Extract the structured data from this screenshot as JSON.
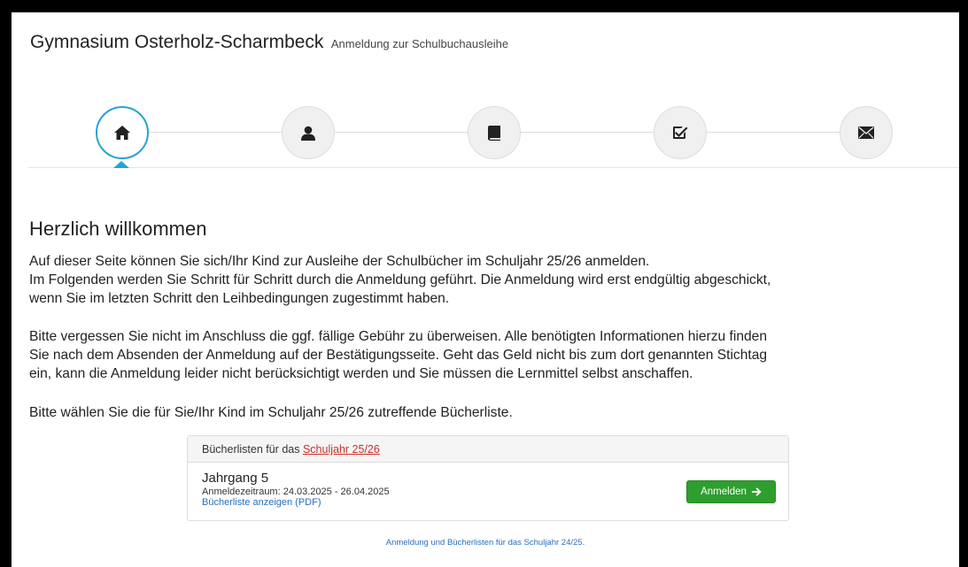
{
  "header": {
    "brand": "Gymnasium Osterholz-Scharmbeck",
    "subtitle": "Anmeldung zur Schulbuchausleihe"
  },
  "wizard": {
    "steps": [
      {
        "icon": "home-icon",
        "active": true
      },
      {
        "icon": "user-icon",
        "active": false
      },
      {
        "icon": "book-icon",
        "active": false
      },
      {
        "icon": "check-square-icon",
        "active": false
      },
      {
        "icon": "envelope-icon",
        "active": false
      }
    ],
    "accent_color": "#27a2d6"
  },
  "content": {
    "heading": "Herzlich willkommen",
    "p1_line1": "Auf dieser Seite können Sie sich/Ihr Kind zur Ausleihe der Schulbücher im Schuljahr 25/26 anmelden.",
    "p1_line2": "Im Folgenden werden Sie Schritt für Schritt durch die Anmeldung geführt. Die Anmeldung wird erst endgültig abgeschickt,",
    "p1_line3": "wenn Sie im letzten Schritt den Leihbedingungen zugestimmt haben.",
    "p2_line1": "Bitte vergessen Sie nicht im Anschluss die ggf. fällige Gebühr zu überweisen. Alle benötigten Informationen hierzu finden",
    "p2_line2": "Sie nach dem Absenden der Anmeldung auf der Bestätigungsseite. Geht das Geld nicht bis zum dort genannten Stichtag",
    "p2_line3": "ein, kann die Anmeldung leider nicht berücksichtigt werden und Sie müssen die Lernmittel selbst anschaffen.",
    "p3": "Bitte wählen Sie die für Sie/Ihr Kind im Schuljahr 25/26 zutreffende Bücherliste."
  },
  "panel": {
    "heading_prefix": "Bücherlisten für das ",
    "heading_link": "Schuljahr 25/26",
    "grade": "Jahrgang 5",
    "period": "Anmeldezeitraum: 24.03.2025 - 26.04.2025",
    "pdf_link": "Bücherliste anzeigen (PDF)",
    "button_label": "Anmelden",
    "button_color": "#2e9e2e"
  },
  "footer": {
    "link": "Anmeldung und Bücherlisten für das Schuljahr 24/25."
  }
}
